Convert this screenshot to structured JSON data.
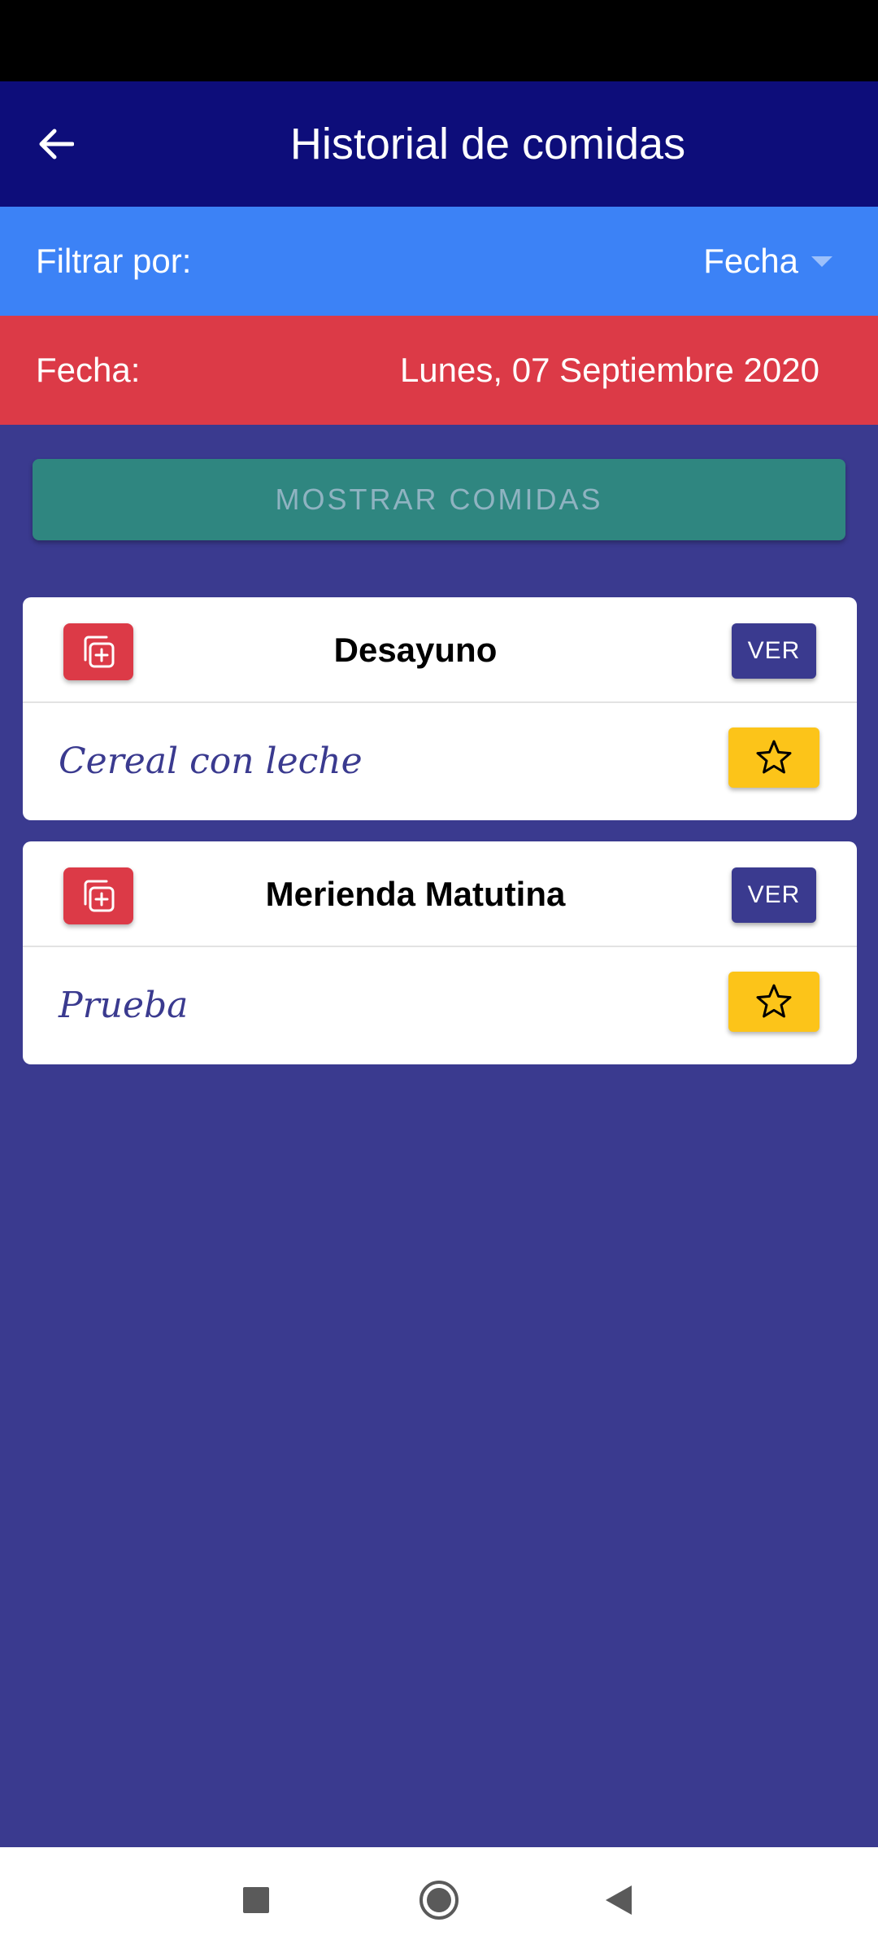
{
  "app_bar": {
    "title": "Historial de comidas",
    "back_icon": "arrow-left-icon"
  },
  "filter": {
    "label": "Filtrar por:",
    "selected": "Fecha"
  },
  "date": {
    "label": "Fecha:",
    "value": "Lunes, 07 Septiembre 2020"
  },
  "show_button": {
    "label": "MOSTRAR COMIDAS"
  },
  "meals": [
    {
      "title": "Desayuno",
      "description": "Cereal con leche",
      "view_label": "VER"
    },
    {
      "title": "Merienda Matutina",
      "description": "Prueba",
      "view_label": "VER"
    }
  ],
  "colors": {
    "app_bar": "#0d0d7a",
    "filter_bar": "#3c82f6",
    "date_bar": "#dc3a47",
    "background": "#3a3a8f",
    "show_button": "#2f8680",
    "favorite": "#fcc419"
  },
  "nav": {
    "icons": [
      "square-stop-icon",
      "circle-home-icon",
      "triangle-back-icon"
    ]
  }
}
